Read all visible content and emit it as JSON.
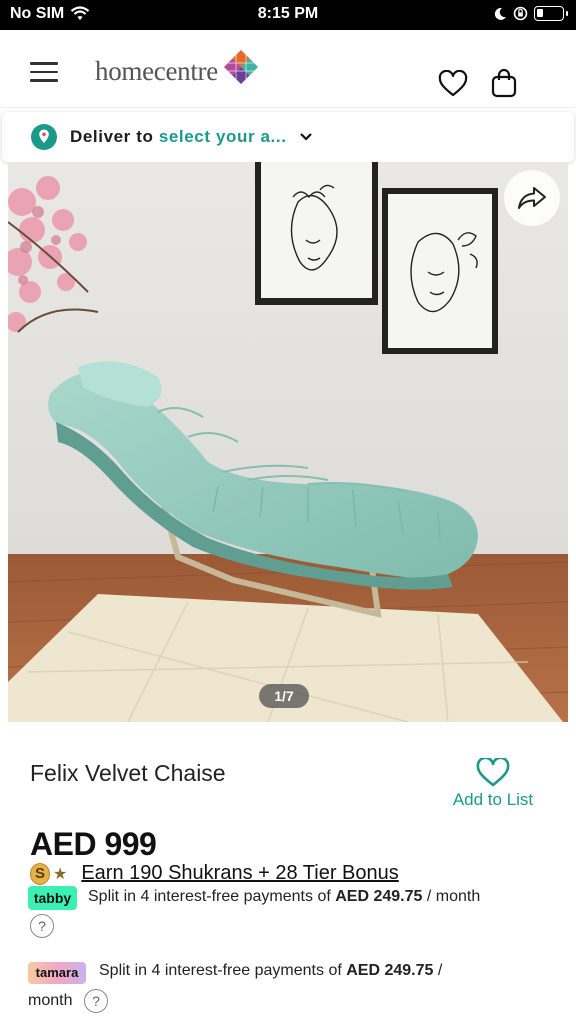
{
  "status_bar": {
    "carrier": "No SIM",
    "time": "8:15 PM",
    "battery_level": 0.25
  },
  "header": {
    "logo_text": "homecentre",
    "menu_icon": "hamburger-icon",
    "wishlist_icon": "heart-icon",
    "cart_icon": "shopping-bag-icon"
  },
  "deliver": {
    "label": "Deliver to",
    "value": "select your a..."
  },
  "gallery": {
    "counter": "1/7",
    "share_icon": "share-icon"
  },
  "product": {
    "name": "Felix Velvet Chaise",
    "add_to_list_label": "Add to List",
    "price": "AED 999"
  },
  "shukran": {
    "coin_letter": "S",
    "star": "★",
    "text": "Earn 190 Shukrans +  28 Tier Bonus"
  },
  "tabby": {
    "badge": "tabby",
    "text_prefix": "Split in 4 interest-free payments of",
    "amount": "AED 249.75",
    "suffix": "/ month",
    "help": "?"
  },
  "tamara": {
    "badge": "tamara",
    "text_prefix": "Split in 4 interest-free payments of",
    "amount": "AED 249.75",
    "suffix": "/",
    "line2": "month",
    "help": "?"
  },
  "colors": {
    "accent": "#1b9a8c",
    "tabby": "#3bf0b3",
    "status_bar": "#000000"
  }
}
